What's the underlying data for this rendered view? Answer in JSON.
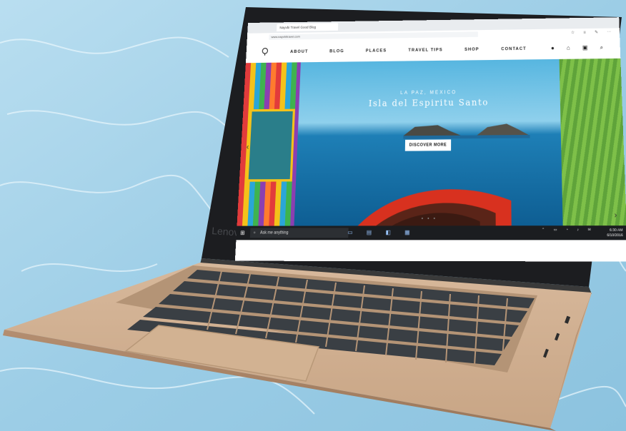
{
  "browser": {
    "tab_title": "Nayvbi Travel Good Blog",
    "address": "www.nayvbitravel.com",
    "toolbar_icons": [
      "favorite-icon",
      "reading-list-icon",
      "share-icon",
      "more-icon"
    ]
  },
  "site": {
    "nav": [
      "ABOUT",
      "BLOG",
      "PLACES",
      "TRAVEL TIPS",
      "SHOP",
      "CONTACT"
    ],
    "header_icons": [
      "bag-icon",
      "cart-icon",
      "calendar-icon",
      "search-icon"
    ]
  },
  "hero": {
    "subtitle": "LA PAZ, MEXICO",
    "title": "Isla del Espiritu Santo",
    "button": "DISCOVER MORE",
    "prev_arrow": "‹",
    "next_arrow": "›",
    "dots": "• • •"
  },
  "taskbar": {
    "search_placeholder": "Ask me anything",
    "time": "6:30 AM",
    "date": "6/10/2016"
  },
  "device": {
    "brand": "Lenovo"
  }
}
